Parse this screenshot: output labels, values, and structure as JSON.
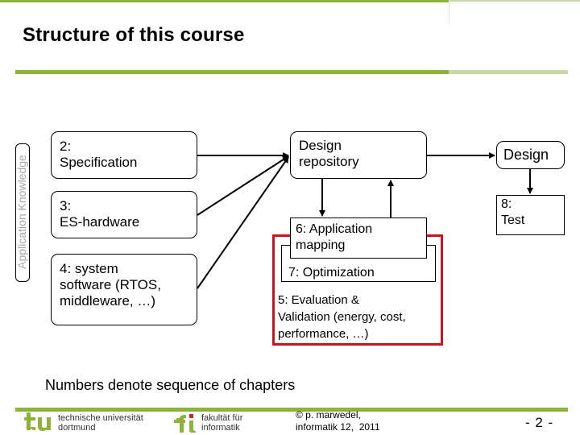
{
  "slide": {
    "title": "Structure of this course",
    "side_label": "Application Knowledge",
    "boxes": {
      "specification": [
        "2:",
        "Specification"
      ],
      "es_hardware": [
        "3:",
        "ES-hardware"
      ],
      "system_software": [
        "4: system",
        "software (RTOS,",
        "middleware, …)"
      ],
      "design_repository": [
        "Design",
        "repository"
      ],
      "design": "Design",
      "test": [
        "8:",
        "Test"
      ],
      "application_mapping": [
        "6: Application",
        "mapping"
      ],
      "optimization": "7: Optimization",
      "evaluation": [
        "5: Evaluation &",
        "Validation (energy, cost,",
        "performance, …)"
      ]
    },
    "note": "Numbers denote sequence of chapters"
  },
  "footer": {
    "university": [
      "technische universität",
      "dortmund"
    ],
    "faculty": [
      "fakultät für",
      "informatik"
    ],
    "copyright": [
      "© p. marwedel,",
      "informatik 12,  2011"
    ],
    "page": "- 2 -"
  },
  "colors": {
    "brand_green": "#8db33a",
    "light_green": "#c9d9a6",
    "highlight_red": "#c8141c",
    "label_grey": "#a8a8a8"
  }
}
